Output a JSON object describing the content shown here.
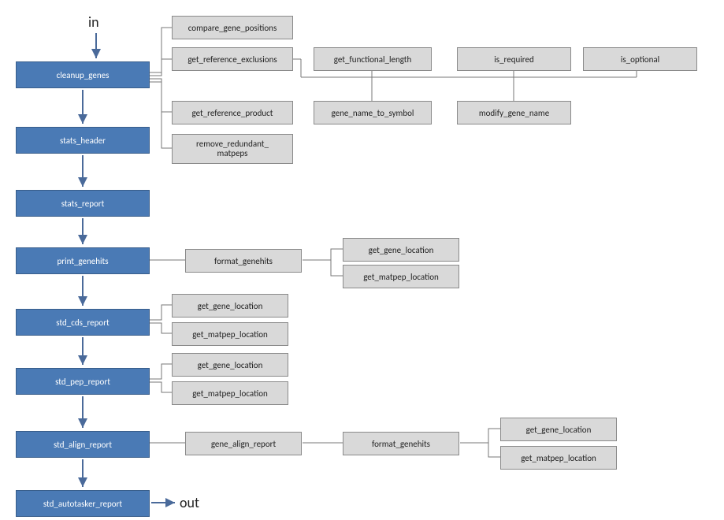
{
  "labels": {
    "in": "in",
    "out": "out"
  },
  "blue": {
    "cleanup_genes": "cleanup_genes",
    "stats_header": "stats_header",
    "stats_report": "stats_report",
    "print_genehits": "print_genehits",
    "std_cds_report": "std_cds_report",
    "std_pep_report": "std_pep_report",
    "std_align_report": "std_align_report",
    "std_autotasker_report": "std_autotasker_report"
  },
  "grey": {
    "compare_gene_positions": "compare_gene_positions",
    "get_reference_exclusions": "get_reference_exclusions",
    "get_functional_length": "get_functional_length",
    "is_required": "is_required",
    "is_optional": "is_optional",
    "get_reference_product": "get_reference_product",
    "gene_name_to_symbol": "gene_name_to_symbol",
    "modify_gene_name": "modify_gene_name",
    "remove_redundant_matpeps": "remove_redundant_\nmatpeps",
    "format_genehits": "format_genehits",
    "get_gene_location": "get_gene_location",
    "get_matpep_location": "get_matpep_location",
    "gene_align_report": "gene_align_report"
  }
}
